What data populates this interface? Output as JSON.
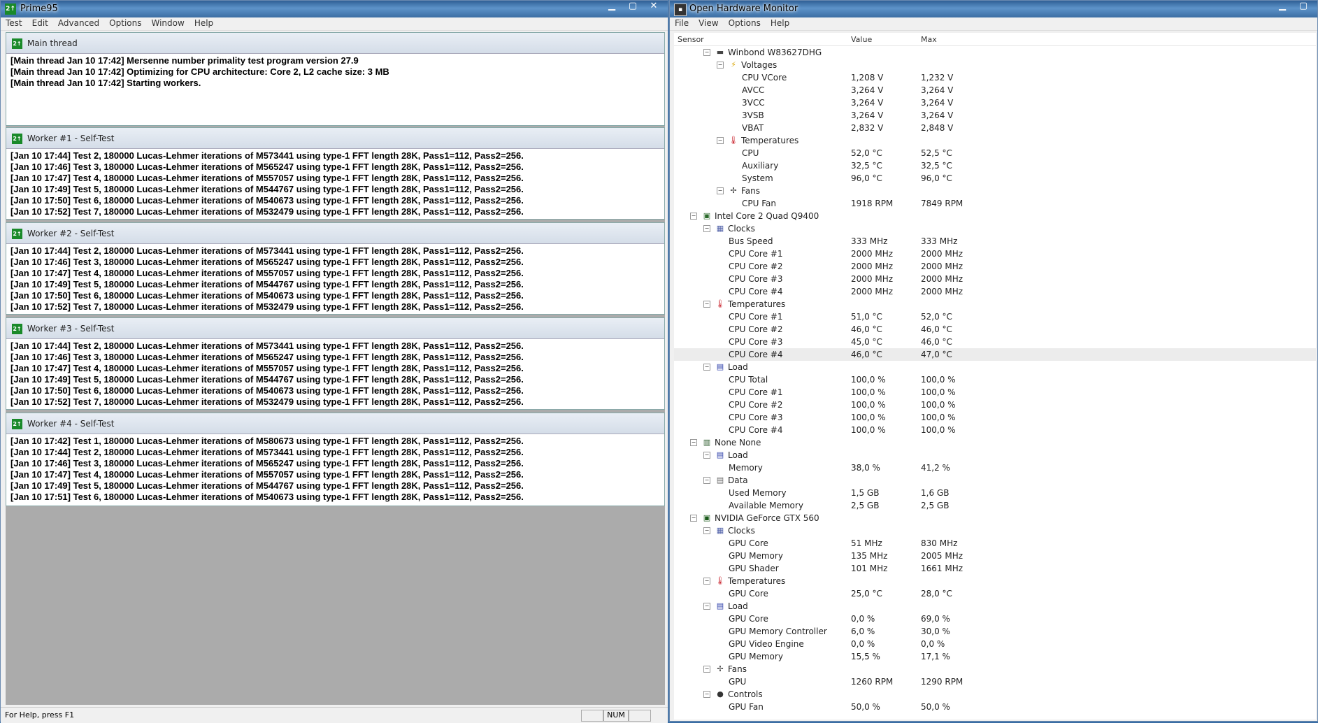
{
  "prime95": {
    "title": "Prime95",
    "menu": [
      "Test",
      "Edit",
      "Advanced",
      "Options",
      "Window",
      "Help"
    ],
    "windows": [
      {
        "title": "Main thread",
        "lines": [
          "[Main thread Jan 10 17:42] Mersenne number primality test program version 27.9",
          "[Main thread Jan 10 17:42] Optimizing for CPU architecture: Core 2, L2 cache size: 3 MB",
          "[Main thread Jan 10 17:42] Starting workers."
        ]
      },
      {
        "title": "Worker #1 - Self-Test",
        "lines": [
          "[Jan 10 17:44] Test 2, 180000 Lucas-Lehmer iterations of M573441 using type-1 FFT length 28K, Pass1=112, Pass2=256.",
          "[Jan 10 17:46] Test 3, 180000 Lucas-Lehmer iterations of M565247 using type-1 FFT length 28K, Pass1=112, Pass2=256.",
          "[Jan 10 17:47] Test 4, 180000 Lucas-Lehmer iterations of M557057 using type-1 FFT length 28K, Pass1=112, Pass2=256.",
          "[Jan 10 17:49] Test 5, 180000 Lucas-Lehmer iterations of M544767 using type-1 FFT length 28K, Pass1=112, Pass2=256.",
          "[Jan 10 17:50] Test 6, 180000 Lucas-Lehmer iterations of M540673 using type-1 FFT length 28K, Pass1=112, Pass2=256.",
          "[Jan 10 17:52] Test 7, 180000 Lucas-Lehmer iterations of M532479 using type-1 FFT length 28K, Pass1=112, Pass2=256."
        ]
      },
      {
        "title": "Worker #2 - Self-Test",
        "lines": [
          "[Jan 10 17:44] Test 2, 180000 Lucas-Lehmer iterations of M573441 using type-1 FFT length 28K, Pass1=112, Pass2=256.",
          "[Jan 10 17:46] Test 3, 180000 Lucas-Lehmer iterations of M565247 using type-1 FFT length 28K, Pass1=112, Pass2=256.",
          "[Jan 10 17:47] Test 4, 180000 Lucas-Lehmer iterations of M557057 using type-1 FFT length 28K, Pass1=112, Pass2=256.",
          "[Jan 10 17:49] Test 5, 180000 Lucas-Lehmer iterations of M544767 using type-1 FFT length 28K, Pass1=112, Pass2=256.",
          "[Jan 10 17:50] Test 6, 180000 Lucas-Lehmer iterations of M540673 using type-1 FFT length 28K, Pass1=112, Pass2=256.",
          "[Jan 10 17:52] Test 7, 180000 Lucas-Lehmer iterations of M532479 using type-1 FFT length 28K, Pass1=112, Pass2=256."
        ]
      },
      {
        "title": "Worker #3 - Self-Test",
        "lines": [
          "[Jan 10 17:44] Test 2, 180000 Lucas-Lehmer iterations of M573441 using type-1 FFT length 28K, Pass1=112, Pass2=256.",
          "[Jan 10 17:46] Test 3, 180000 Lucas-Lehmer iterations of M565247 using type-1 FFT length 28K, Pass1=112, Pass2=256.",
          "[Jan 10 17:47] Test 4, 180000 Lucas-Lehmer iterations of M557057 using type-1 FFT length 28K, Pass1=112, Pass2=256.",
          "[Jan 10 17:49] Test 5, 180000 Lucas-Lehmer iterations of M544767 using type-1 FFT length 28K, Pass1=112, Pass2=256.",
          "[Jan 10 17:50] Test 6, 180000 Lucas-Lehmer iterations of M540673 using type-1 FFT length 28K, Pass1=112, Pass2=256.",
          "[Jan 10 17:52] Test 7, 180000 Lucas-Lehmer iterations of M532479 using type-1 FFT length 28K, Pass1=112, Pass2=256."
        ]
      },
      {
        "title": "Worker #4 - Self-Test",
        "lines": [
          "[Jan 10 17:42] Test 1, 180000 Lucas-Lehmer iterations of M580673 using type-1 FFT length 28K, Pass1=112, Pass2=256.",
          "[Jan 10 17:44] Test 2, 180000 Lucas-Lehmer iterations of M573441 using type-1 FFT length 28K, Pass1=112, Pass2=256.",
          "[Jan 10 17:46] Test 3, 180000 Lucas-Lehmer iterations of M565247 using type-1 FFT length 28K, Pass1=112, Pass2=256.",
          "[Jan 10 17:47] Test 4, 180000 Lucas-Lehmer iterations of M557057 using type-1 FFT length 28K, Pass1=112, Pass2=256.",
          "[Jan 10 17:49] Test 5, 180000 Lucas-Lehmer iterations of M544767 using type-1 FFT length 28K, Pass1=112, Pass2=256.",
          "[Jan 10 17:51] Test 6, 180000 Lucas-Lehmer iterations of M540673 using type-1 FFT length 28K, Pass1=112, Pass2=256."
        ]
      }
    ],
    "status": {
      "help": "For Help, press F1",
      "num": "NUM"
    }
  },
  "ohm": {
    "title": "Open Hardware Monitor",
    "menu": [
      "File",
      "View",
      "Options",
      "Help"
    ],
    "columns": {
      "sensor": "Sensor",
      "value": "Value",
      "max": "Max"
    },
    "rows": [
      {
        "level": 3,
        "type": "hw",
        "icon": "chip-icon",
        "label": "Winbond W83627DHG"
      },
      {
        "level": 4,
        "type": "group",
        "icon": "voltage-icon",
        "label": "Voltages"
      },
      {
        "level": 5,
        "type": "sensor",
        "label": "CPU VCore",
        "value": "1,208 V",
        "max": "1,232 V"
      },
      {
        "level": 5,
        "type": "sensor",
        "label": "AVCC",
        "value": "3,264 V",
        "max": "3,264 V"
      },
      {
        "level": 5,
        "type": "sensor",
        "label": "3VCC",
        "value": "3,264 V",
        "max": "3,264 V"
      },
      {
        "level": 5,
        "type": "sensor",
        "label": "3VSB",
        "value": "3,264 V",
        "max": "3,264 V"
      },
      {
        "level": 5,
        "type": "sensor",
        "label": "VBAT",
        "value": "2,832 V",
        "max": "2,848 V"
      },
      {
        "level": 4,
        "type": "group",
        "icon": "thermometer-icon",
        "label": "Temperatures"
      },
      {
        "level": 5,
        "type": "sensor",
        "label": "CPU",
        "value": "52,0 °C",
        "max": "52,5 °C"
      },
      {
        "level": 5,
        "type": "sensor",
        "label": "Auxiliary",
        "value": "32,5 °C",
        "max": "32,5 °C"
      },
      {
        "level": 5,
        "type": "sensor",
        "label": "System",
        "value": "96,0 °C",
        "max": "96,0 °C"
      },
      {
        "level": 4,
        "type": "group",
        "icon": "fan-icon",
        "label": "Fans"
      },
      {
        "level": 5,
        "type": "sensor",
        "label": "CPU Fan",
        "value": "1918 RPM",
        "max": "7849 RPM"
      },
      {
        "level": 2,
        "type": "hw",
        "icon": "cpu-icon",
        "label": "Intel Core 2 Quad Q9400"
      },
      {
        "level": 3,
        "type": "group",
        "icon": "clock-icon",
        "label": "Clocks"
      },
      {
        "level": 4,
        "type": "sensor",
        "label": "Bus Speed",
        "value": "333 MHz",
        "max": "333 MHz"
      },
      {
        "level": 4,
        "type": "sensor",
        "label": "CPU Core #1",
        "value": "2000 MHz",
        "max": "2000 MHz"
      },
      {
        "level": 4,
        "type": "sensor",
        "label": "CPU Core #2",
        "value": "2000 MHz",
        "max": "2000 MHz"
      },
      {
        "level": 4,
        "type": "sensor",
        "label": "CPU Core #3",
        "value": "2000 MHz",
        "max": "2000 MHz"
      },
      {
        "level": 4,
        "type": "sensor",
        "label": "CPU Core #4",
        "value": "2000 MHz",
        "max": "2000 MHz"
      },
      {
        "level": 3,
        "type": "group",
        "icon": "thermometer-icon",
        "label": "Temperatures"
      },
      {
        "level": 4,
        "type": "sensor",
        "label": "CPU Core #1",
        "value": "51,0 °C",
        "max": "52,0 °C"
      },
      {
        "level": 4,
        "type": "sensor",
        "label": "CPU Core #2",
        "value": "46,0 °C",
        "max": "46,0 °C"
      },
      {
        "level": 4,
        "type": "sensor",
        "label": "CPU Core #3",
        "value": "45,0 °C",
        "max": "46,0 °C"
      },
      {
        "level": 4,
        "type": "sensor",
        "label": "CPU Core #4",
        "value": "46,0 °C",
        "max": "47,0 °C",
        "highlight": true
      },
      {
        "level": 3,
        "type": "group",
        "icon": "load-icon",
        "label": "Load"
      },
      {
        "level": 4,
        "type": "sensor",
        "label": "CPU Total",
        "value": "100,0 %",
        "max": "100,0 %"
      },
      {
        "level": 4,
        "type": "sensor",
        "label": "CPU Core #1",
        "value": "100,0 %",
        "max": "100,0 %"
      },
      {
        "level": 4,
        "type": "sensor",
        "label": "CPU Core #2",
        "value": "100,0 %",
        "max": "100,0 %"
      },
      {
        "level": 4,
        "type": "sensor",
        "label": "CPU Core #3",
        "value": "100,0 %",
        "max": "100,0 %"
      },
      {
        "level": 4,
        "type": "sensor",
        "label": "CPU Core #4",
        "value": "100,0 %",
        "max": "100,0 %"
      },
      {
        "level": 2,
        "type": "hw",
        "icon": "ram-icon",
        "label": "None None"
      },
      {
        "level": 3,
        "type": "group",
        "icon": "load-icon",
        "label": "Load"
      },
      {
        "level": 4,
        "type": "sensor",
        "label": "Memory",
        "value": "38,0 %",
        "max": "41,2 %"
      },
      {
        "level": 3,
        "type": "group",
        "icon": "data-icon",
        "label": "Data"
      },
      {
        "level": 4,
        "type": "sensor",
        "label": "Used Memory",
        "value": "1,5 GB",
        "max": "1,6 GB"
      },
      {
        "level": 4,
        "type": "sensor",
        "label": "Available Memory",
        "value": "2,5 GB",
        "max": "2,5 GB"
      },
      {
        "level": 2,
        "type": "hw",
        "icon": "gpu-icon",
        "label": "NVIDIA GeForce GTX 560"
      },
      {
        "level": 3,
        "type": "group",
        "icon": "clock-icon",
        "label": "Clocks"
      },
      {
        "level": 4,
        "type": "sensor",
        "label": "GPU Core",
        "value": "51 MHz",
        "max": "830 MHz"
      },
      {
        "level": 4,
        "type": "sensor",
        "label": "GPU Memory",
        "value": "135 MHz",
        "max": "2005 MHz"
      },
      {
        "level": 4,
        "type": "sensor",
        "label": "GPU Shader",
        "value": "101 MHz",
        "max": "1661 MHz"
      },
      {
        "level": 3,
        "type": "group",
        "icon": "thermometer-icon",
        "label": "Temperatures"
      },
      {
        "level": 4,
        "type": "sensor",
        "label": "GPU Core",
        "value": "25,0 °C",
        "max": "28,0 °C"
      },
      {
        "level": 3,
        "type": "group",
        "icon": "load-icon",
        "label": "Load"
      },
      {
        "level": 4,
        "type": "sensor",
        "label": "GPU Core",
        "value": "0,0 %",
        "max": "69,0 %"
      },
      {
        "level": 4,
        "type": "sensor",
        "label": "GPU Memory Controller",
        "value": "6,0 %",
        "max": "30,0 %"
      },
      {
        "level": 4,
        "type": "sensor",
        "label": "GPU Video Engine",
        "value": "0,0 %",
        "max": "0,0 %"
      },
      {
        "level": 4,
        "type": "sensor",
        "label": "GPU Memory",
        "value": "15,5 %",
        "max": "17,1 %"
      },
      {
        "level": 3,
        "type": "group",
        "icon": "fan-icon",
        "label": "Fans"
      },
      {
        "level": 4,
        "type": "sensor",
        "label": "GPU",
        "value": "1260 RPM",
        "max": "1290 RPM"
      },
      {
        "level": 3,
        "type": "group",
        "icon": "controls-icon",
        "label": "Controls"
      },
      {
        "level": 4,
        "type": "sensor",
        "label": "GPU Fan",
        "value": "50,0 %",
        "max": "50,0 %"
      }
    ]
  }
}
